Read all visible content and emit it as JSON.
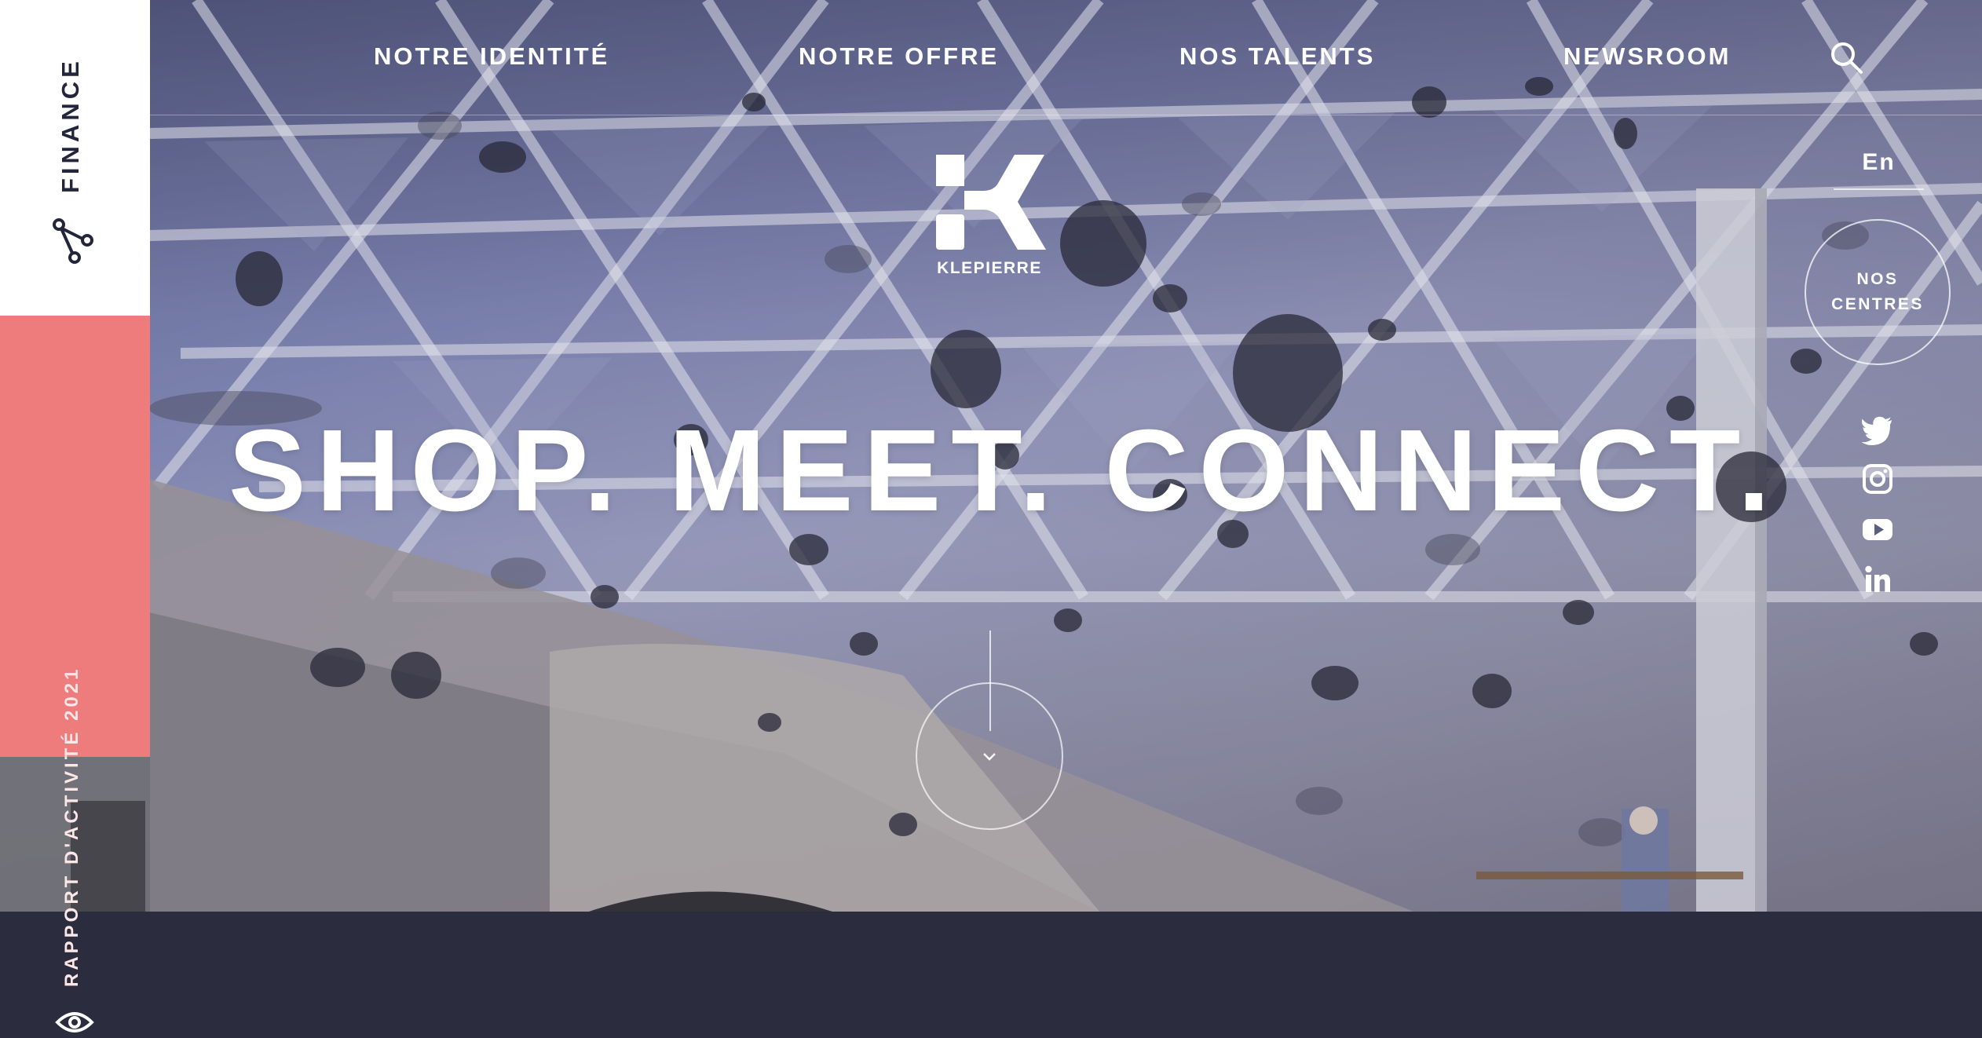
{
  "sidebar": {
    "finance_label": "FINANCE",
    "report_label": "RAPPORT D'ACTIVITÉ 2021",
    "finance_icon": "share-nodes-icon",
    "report_icon": "eye-icon"
  },
  "nav": {
    "items": [
      {
        "label": "NOTRE IDENTITÉ"
      },
      {
        "label": "NOTRE OFFRE"
      },
      {
        "label": "NOS TALENTS"
      },
      {
        "label": "NEWSROOM"
      }
    ],
    "search_icon": "search-icon"
  },
  "logo": {
    "text": "KLEPIERRE"
  },
  "right": {
    "language": "En",
    "centres_line1": "NOS",
    "centres_line2": "CENTRES",
    "social": [
      "twitter-icon",
      "instagram-icon",
      "youtube-icon",
      "linkedin-icon"
    ]
  },
  "hero": {
    "headline": "SHOP. MEET. CONNECT."
  },
  "colors": {
    "sidebar_white": "#ffffff",
    "sidebar_pink": "#ee7c7c",
    "navy": "#23253a",
    "text_light": "#ffffff"
  }
}
